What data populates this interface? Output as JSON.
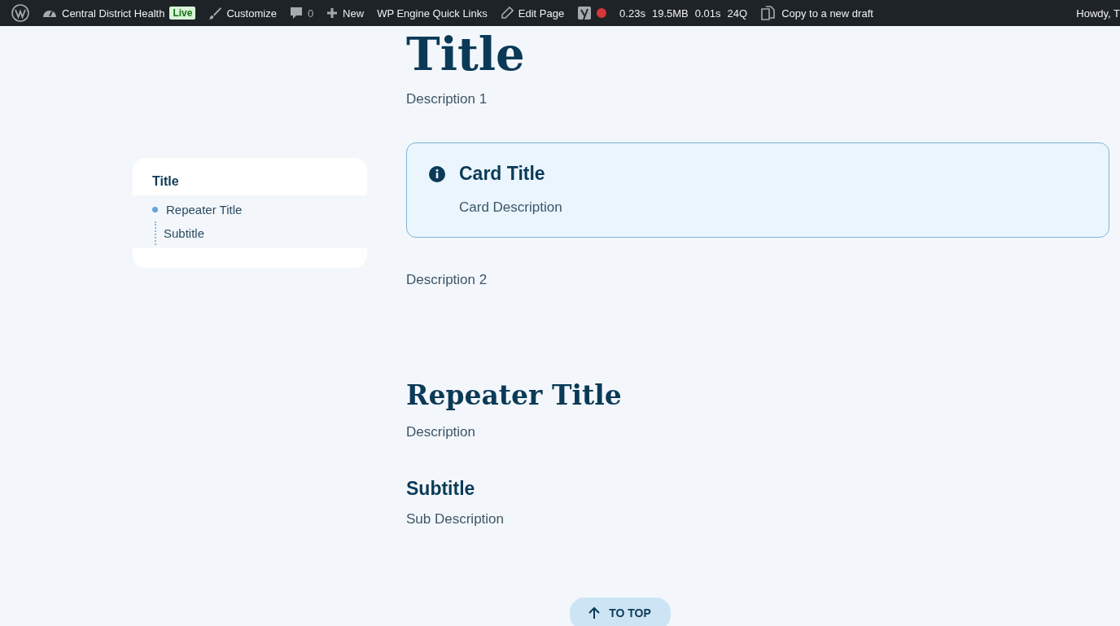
{
  "admin_bar": {
    "site_name": "Central District Health",
    "live_badge": "Live",
    "customize": "Customize",
    "comments_count": "0",
    "new": "New",
    "quick_links": "WP Engine Quick Links",
    "edit_page": "Edit Page",
    "stats": [
      "0.23s",
      "19.5MB",
      "0.01s",
      "24Q"
    ],
    "copy_draft": "Copy to a new draft",
    "howdy": "Howdy, T"
  },
  "toc": {
    "title": "Title",
    "items": [
      {
        "label": "Repeater Title",
        "selected": true,
        "children": [
          {
            "label": "Subtitle",
            "selected": false
          }
        ]
      }
    ]
  },
  "content": {
    "title": "Title",
    "description_1": "Description 1",
    "card": {
      "title": "Card Title",
      "description": "Card Description"
    },
    "description_2": "Description 2",
    "sections": [
      {
        "title": "Repeater Title",
        "description": "Description",
        "children": [
          {
            "title": "Subtitle",
            "description": "Sub Description"
          }
        ]
      }
    ]
  },
  "to_top": "TO TOP"
}
